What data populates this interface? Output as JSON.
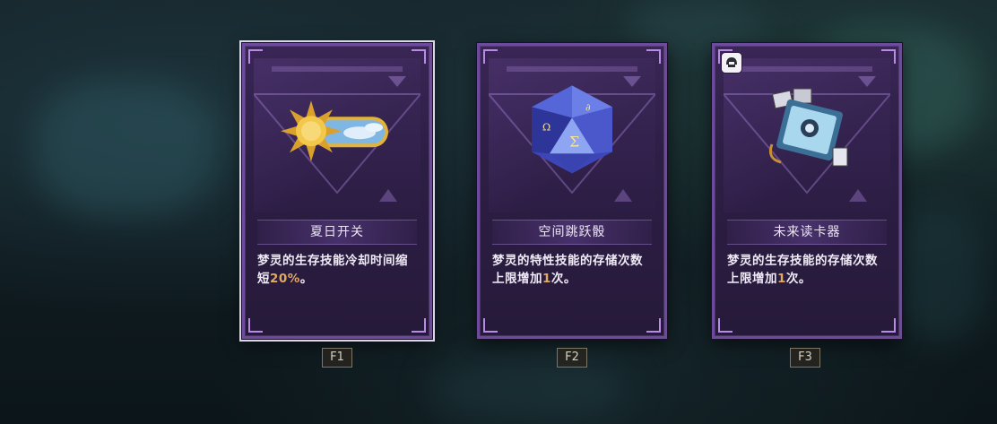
{
  "cards": [
    {
      "title": "夏日开关",
      "desc_prefix": "梦灵的生存技能冷却时间缩短",
      "desc_number": "20%",
      "desc_suffix": "。",
      "hotkey": "F1",
      "icon": "sun-switch-icon",
      "selected": true
    },
    {
      "title": "空间跳跃骰",
      "desc_prefix": "梦灵的特性技能的存储次数上限增加",
      "desc_number": "1",
      "desc_suffix": "次。",
      "hotkey": "F2",
      "icon": "d20-dice-icon",
      "selected": false
    },
    {
      "title": "未来读卡器",
      "desc_prefix": "梦灵的生存技能的存储次数上限增加",
      "desc_number": "1",
      "desc_suffix": "次。",
      "hotkey": "F3",
      "icon": "card-reader-icon",
      "badge_icon": "helmet-badge-icon",
      "selected": false
    }
  ],
  "colors": {
    "card_border": "#6e4a9c",
    "card_fill": "#2d1e45",
    "highlight_number": "#e0a860",
    "selected_outline": "#d9d6e6"
  }
}
